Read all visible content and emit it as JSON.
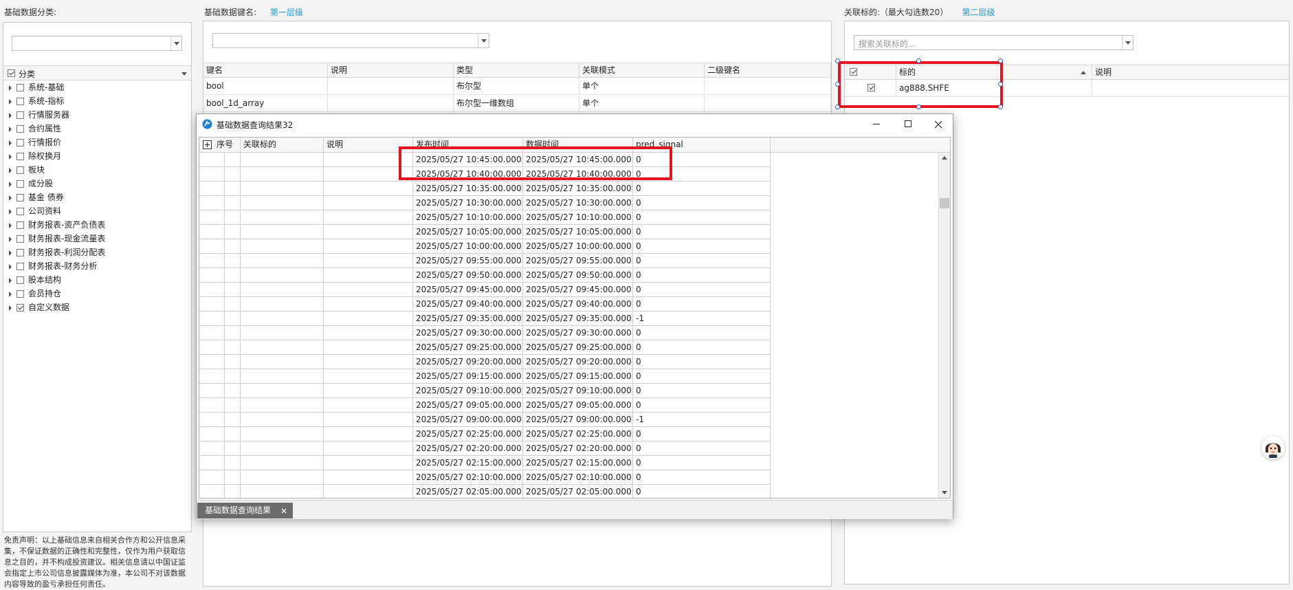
{
  "left": {
    "title": "基础数据分类:",
    "tree_header": "分类",
    "tree_items": [
      {
        "label": "系统-基础",
        "checked": false
      },
      {
        "label": "系统-指标",
        "checked": false
      },
      {
        "label": "行情服务器",
        "checked": false
      },
      {
        "label": "合约属性",
        "checked": false
      },
      {
        "label": "行情报价",
        "checked": false
      },
      {
        "label": "除权换月",
        "checked": false
      },
      {
        "label": "板块",
        "checked": false
      },
      {
        "label": "成分股",
        "checked": false
      },
      {
        "label": "基金 债券",
        "checked": false
      },
      {
        "label": "公司资料",
        "checked": false
      },
      {
        "label": "财务报表-资产负债表",
        "checked": false
      },
      {
        "label": "财务报表-现金流量表",
        "checked": false
      },
      {
        "label": "财务报表-利润分配表",
        "checked": false
      },
      {
        "label": "财务报表-财务分析",
        "checked": false
      },
      {
        "label": "股本结构",
        "checked": false
      },
      {
        "label": "会员持仓",
        "checked": false
      },
      {
        "label": "自定义数据",
        "checked": true
      }
    ],
    "disclaimer": "免责声明：以上基础信息来自相关合作方和公开信息采集，不保证数据的正确性和完整性，仅作为用户获取信息之目的，并不构成投资建议。相关信息请以中国证监会指定上市公司信息披露媒体为准，本公司不对该数据内容导致的盈亏承担任何责任。"
  },
  "middle": {
    "title": "基础数据键名:",
    "level_link": "第一层级",
    "columns": [
      "键名",
      "说明",
      "类型",
      "关联模式",
      "二级键名"
    ],
    "rows": [
      [
        "bool",
        "",
        "布尔型",
        "单个",
        ""
      ],
      [
        "bool_1d_array",
        "",
        "布尔型一维数组",
        "单个",
        ""
      ]
    ]
  },
  "right": {
    "title": "关联标的:（最大勾选数20）",
    "level_link": "第二层级",
    "search_placeholder": "搜索关联标的...",
    "columns": [
      "标的",
      "说明"
    ],
    "rows": [
      {
        "symbol": "ag888.SHFE",
        "note": "",
        "checked": true
      }
    ]
  },
  "dialog": {
    "title": "基础数据查询结果32",
    "columns": [
      "序号",
      "关联标的",
      "说明",
      "发布时间",
      "数据时间",
      "pred_signal"
    ],
    "rows": [
      [
        "2025/05/27 10:45:00.000",
        "2025/05/27 10:45:00.000",
        "0"
      ],
      [
        "2025/05/27 10:40:00.000",
        "2025/05/27 10:40:00.000",
        "0"
      ],
      [
        "2025/05/27 10:35:00.000",
        "2025/05/27 10:35:00.000",
        "0"
      ],
      [
        "2025/05/27 10:30:00.000",
        "2025/05/27 10:30:00.000",
        "0"
      ],
      [
        "2025/05/27 10:10:00.000",
        "2025/05/27 10:10:00.000",
        "0"
      ],
      [
        "2025/05/27 10:05:00.000",
        "2025/05/27 10:05:00.000",
        "0"
      ],
      [
        "2025/05/27 10:00:00.000",
        "2025/05/27 10:00:00.000",
        "0"
      ],
      [
        "2025/05/27 09:55:00.000",
        "2025/05/27 09:55:00.000",
        "0"
      ],
      [
        "2025/05/27 09:50:00.000",
        "2025/05/27 09:50:00.000",
        "0"
      ],
      [
        "2025/05/27 09:45:00.000",
        "2025/05/27 09:45:00.000",
        "0"
      ],
      [
        "2025/05/27 09:40:00.000",
        "2025/05/27 09:40:00.000",
        "0"
      ],
      [
        "2025/05/27 09:35:00.000",
        "2025/05/27 09:35:00.000",
        "-1"
      ],
      [
        "2025/05/27 09:30:00.000",
        "2025/05/27 09:30:00.000",
        "0"
      ],
      [
        "2025/05/27 09:25:00.000",
        "2025/05/27 09:25:00.000",
        "0"
      ],
      [
        "2025/05/27 09:20:00.000",
        "2025/05/27 09:20:00.000",
        "0"
      ],
      [
        "2025/05/27 09:15:00.000",
        "2025/05/27 09:15:00.000",
        "0"
      ],
      [
        "2025/05/27 09:10:00.000",
        "2025/05/27 09:10:00.000",
        "0"
      ],
      [
        "2025/05/27 09:05:00.000",
        "2025/05/27 09:05:00.000",
        "0"
      ],
      [
        "2025/05/27 09:00:00.000",
        "2025/05/27 09:00:00.000",
        "-1"
      ],
      [
        "2025/05/27 02:25:00.000",
        "2025/05/27 02:25:00.000",
        "0"
      ],
      [
        "2025/05/27 02:20:00.000",
        "2025/05/27 02:20:00.000",
        "0"
      ],
      [
        "2025/05/27 02:15:00.000",
        "2025/05/27 02:15:00.000",
        "0"
      ],
      [
        "2025/05/27 02:10:00.000",
        "2025/05/27 02:10:00.000",
        "0"
      ],
      [
        "2025/05/27 02:05:00.000",
        "2025/05/27 02:05:00.000",
        "0"
      ]
    ],
    "tab_label": "基础数据查询结果"
  },
  "icons": {
    "app": "app-logo-icon",
    "minimize": "minimize-icon",
    "maximize": "maximize-icon",
    "close": "close-icon",
    "expand_all": "plus-box-icon",
    "assistant": "assistant-avatar-icon"
  },
  "colors": {
    "accent_link": "#1e9ad6",
    "highlight_red": "#e5131f",
    "tab_bg": "#6b6b6b"
  }
}
